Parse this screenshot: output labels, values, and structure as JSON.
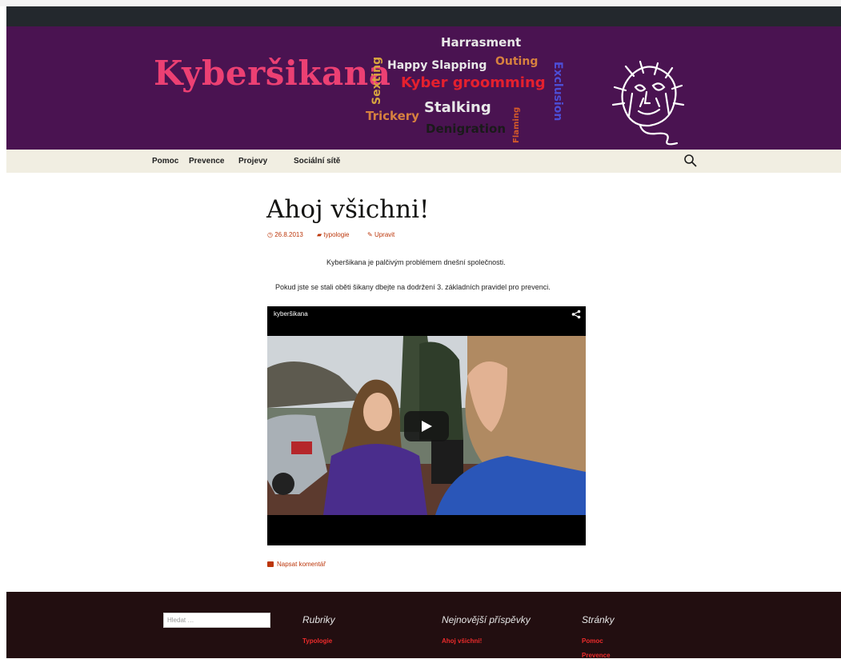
{
  "header": {
    "site_title": "Kyberšikana",
    "word_cloud": [
      {
        "text": "Harrasment",
        "color": "#e8e8e8"
      },
      {
        "text": "Happy Slapping",
        "color": "#e8e8e8"
      },
      {
        "text": "Outing",
        "color": "#d7813f"
      },
      {
        "text": "Kyber groomming",
        "color": "#e4202e"
      },
      {
        "text": "Stalking",
        "color": "#e8e8e8"
      },
      {
        "text": "Trickery",
        "color": "#d7813f"
      },
      {
        "text": "Denigration",
        "color": "#1a1a1a"
      },
      {
        "text": "Sexting",
        "color": "#d7a43f"
      },
      {
        "text": "Flaming",
        "color": "#d45a2a"
      },
      {
        "text": "Exclusion",
        "color": "#4d4dd6"
      }
    ]
  },
  "nav": {
    "items": [
      {
        "label": "Pomoc"
      },
      {
        "label": "Prevence"
      },
      {
        "label": "Projevy"
      },
      {
        "label": "Sociální sítě"
      }
    ],
    "search_icon": "search-icon"
  },
  "post": {
    "title": "Ahoj všichni!",
    "date": "26.8.2013",
    "category": "typologie",
    "edit": "Upravit",
    "paragraph1": "Kyberšikana je palčivým problémem dnešní společnosti.",
    "paragraph2": "Pokud jste se stali oběti šikany dbejte na dodržení 3. základních pravidel pro prevenci.",
    "video_title": "kyberšikana",
    "comment_link": "Napsat komentář"
  },
  "footer": {
    "search_placeholder": "Hledat …",
    "widgets": [
      {
        "title": "Rubriky",
        "links": [
          "Typologie"
        ]
      },
      {
        "title": "Nejnovější příspěvky",
        "links": [
          "Ahoj všichni!"
        ]
      },
      {
        "title": "Stránky",
        "links": [
          "Pomoc",
          "Prevence"
        ]
      }
    ]
  },
  "colors": {
    "header_bg": "#4a1351",
    "accent": "#bc360a",
    "title_pink": "#ec4073",
    "footer_bg": "#220e10",
    "nav_bg": "#f1eee2"
  }
}
